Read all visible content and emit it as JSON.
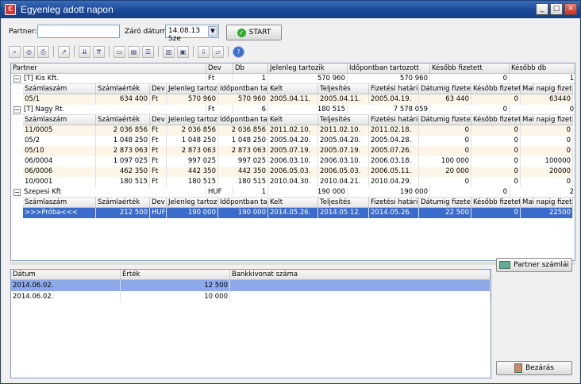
{
  "window": {
    "title": "Egyenleg adott napon"
  },
  "form": {
    "partner_label": "Partner:",
    "partner_value": "",
    "date_label": "Záró dátum:",
    "date_value": "14.08.13 Sze",
    "start_label": "START"
  },
  "main_headers": [
    "Partner",
    "Dev",
    "Db",
    "Jelenleg tartozik",
    "Időpontban tartozott",
    "Később fizetett",
    "Később db"
  ],
  "sub_headers": [
    "Számlaszám",
    "Számlaérték",
    "Dev",
    "Jelenleg tartozik",
    "Időpontban tartoz",
    "Kelt",
    "Teljesítés",
    "Fizetési határidő",
    "Dátumig fizetett",
    "Később fizetett",
    "Mai napig fizetett"
  ],
  "partners": [
    {
      "name": "[T] Kis Kft.",
      "dev": "Ft",
      "db": "1",
      "jelenleg": "570 960",
      "idopontban": "570 960",
      "kesobb": "0",
      "kesobb_db": "1",
      "invoices": [
        [
          "05/1",
          "634 400",
          "Ft",
          "570 960",
          "570 960",
          "2005.04.11.",
          "2005.04.11.",
          "2005.04.19.",
          "63 440",
          "0",
          "63440"
        ]
      ]
    },
    {
      "name": "[T] Nagy Rt.",
      "dev": "Ft",
      "db": "6",
      "jelenleg": "180 515",
      "idopontban": "7 578 059",
      "kesobb": "0",
      "kesobb_db": "0",
      "invoices": [
        [
          "11/0005",
          "2 036 856",
          "Ft",
          "2 036 856",
          "2 036 856",
          "2011.02.10.",
          "2011.02.10.",
          "2011.02.18.",
          "0",
          "0",
          "0"
        ],
        [
          "05/2",
          "1 048 250",
          "Ft",
          "1 048 250",
          "1 048 250",
          "2005.04.20.",
          "2005.04.20.",
          "2005.04.28.",
          "0",
          "0",
          "0"
        ],
        [
          "05/10",
          "2 873 063",
          "Ft",
          "2 873 063",
          "2 873 063",
          "2005.07.19.",
          "2005.07.19.",
          "2005.07.26.",
          "0",
          "0",
          "0"
        ],
        [
          "06/0004",
          "1 097 025",
          "Ft",
          "997 025",
          "997 025",
          "2006.03.10.",
          "2006.03.10.",
          "2006.03.18.",
          "100 000",
          "0",
          "100000"
        ],
        [
          "06/0006",
          "462 350",
          "Ft",
          "442 350",
          "442 350",
          "2006.05.03.",
          "2006.05.03.",
          "2006.05.11.",
          "20 000",
          "0",
          "20000"
        ],
        [
          "10/0001",
          "180 515",
          "Ft",
          "180 515",
          "180 515",
          "2010.04.30.",
          "2010.04.21.",
          "2010.04.29.",
          "0",
          "0",
          "0"
        ]
      ]
    },
    {
      "name": "Szepesi Kft",
      "dev": "HUF",
      "db": "1",
      "jelenleg": "190 000",
      "idopontban": "190 000",
      "kesobb": "0",
      "kesobb_db": "2",
      "invoices": [
        [
          ">>>Próba<<<",
          "212 500",
          "HUF",
          "190 000",
          "190 000",
          "2014.05.26.",
          "2014.05.12.",
          "2014.05.26.",
          "22 500",
          "0",
          "22500"
        ]
      ]
    }
  ],
  "payments": {
    "headers": [
      "Dátum",
      "Érték",
      "Bankkivonat száma"
    ],
    "rows": [
      [
        "2014.06.02.",
        "12 500",
        ""
      ],
      [
        "2014.06.02.",
        "10 000",
        ""
      ]
    ]
  },
  "buttons": {
    "partner_accounts": "Partner számlái",
    "close": "Bezárás"
  }
}
